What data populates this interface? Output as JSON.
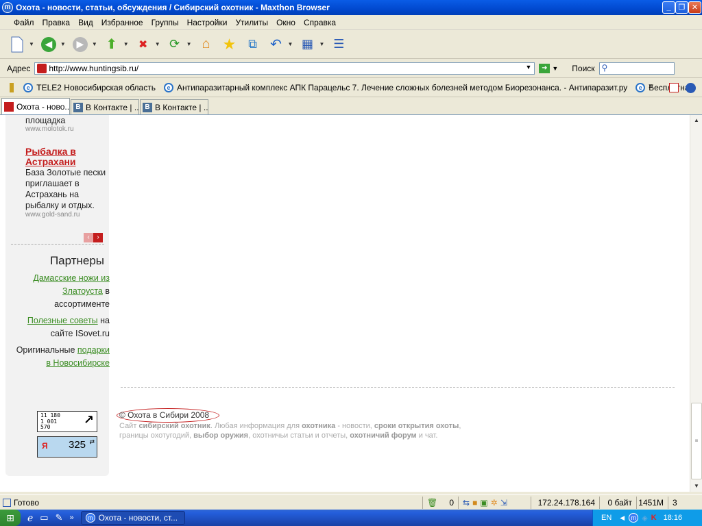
{
  "window": {
    "title": "Охота - новости, статьи, обсуждения / Сибирский охотник - Maxthon Browser"
  },
  "menu": [
    "Файл",
    "Правка",
    "Вид",
    "Избранное",
    "Группы",
    "Настройки",
    "Утилиты",
    "Окно",
    "Справка"
  ],
  "address": {
    "label": "Адрес",
    "url": "http://www.huntingsib.ru/",
    "search_label": "Поиск"
  },
  "favorites": [
    "TELE2 Новосибирская область",
    "Антипаразитарный комплекс АПК Парацельс 7. Лечение сложных болезней методом Биорезонанса. - Антипаразит.ру",
    "Бесплатная"
  ],
  "tabs": [
    {
      "label": "Охота - ново...",
      "icon": "page-icon"
    },
    {
      "label": "В Контакте | ...",
      "icon": "vk-icon"
    },
    {
      "label": "В Контакте | ...",
      "icon": "vk-icon"
    }
  ],
  "sidebar": {
    "ad1": {
      "text_tail": "площадка",
      "url": "www.molotok.ru"
    },
    "ad2": {
      "title": "Рыбалка в Астрахани",
      "text": "База Золотые пески приглашает в Астрахань на рыбалку и отдых.",
      "url": "www.gold-sand.ru"
    },
    "partners_title": "Партнеры",
    "partners": [
      {
        "link": "Дамасские ножи из Златоуста",
        "text": " в ассортименте"
      },
      {
        "link": "Полезные советы",
        "text": " на сайте ISovet.ru"
      },
      {
        "prefix": "Оригинальные ",
        "link": "подарки в Новосибирске"
      }
    ],
    "counter1": {
      "lines": [
        "11 180",
        "1 001",
        "570"
      ]
    },
    "counter2": {
      "label": "Я",
      "value": "325"
    }
  },
  "footer": {
    "copyright": "© Охота в Сибири 2008",
    "t1": "Сайт ",
    "b1": "сибирский охотник",
    "t2": ". Любая информация для ",
    "b2": "охотника",
    "t3": " - новости, ",
    "b3": "сроки открытия охоты",
    "t4": ", границы охотугодий, ",
    "b4": "выбор оружия",
    "t5": ", охотничьи статьи и отчеты, ",
    "b5": "охотничий форум",
    "t6": " и чат."
  },
  "status": {
    "text": "Готово",
    "count": "0",
    "ip": "172.24.178.164",
    "bytes": "0 байт",
    "memory": "1451M",
    "windows": "3"
  },
  "taskbar": {
    "active_task": "Охота - новости, ст...",
    "lang": "EN",
    "time": "18:16"
  }
}
